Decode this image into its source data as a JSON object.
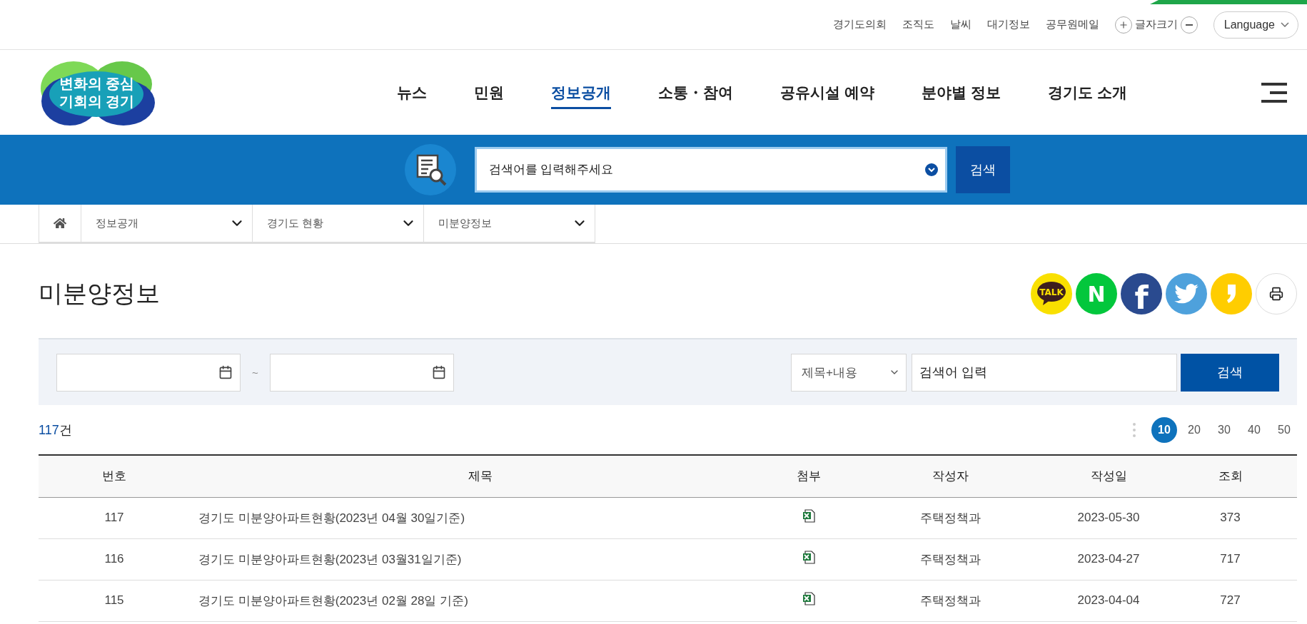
{
  "utility_links": [
    "경기도의회",
    "조직도",
    "날씨",
    "대기정보",
    "공무원메일"
  ],
  "font_size": {
    "label": "글자크기"
  },
  "language": {
    "label": "Language"
  },
  "logo": {
    "lines": [
      "변화의 중심",
      "기회의 경기"
    ]
  },
  "nav": [
    {
      "label": "뉴스",
      "selected": false
    },
    {
      "label": "민원",
      "selected": false
    },
    {
      "label": "정보공개",
      "selected": true
    },
    {
      "label": "소통・참여",
      "selected": false
    },
    {
      "label": "공유시설 예약",
      "selected": false
    },
    {
      "label": "분야별 정보",
      "selected": false
    },
    {
      "label": "경기도 소개",
      "selected": false
    }
  ],
  "search": {
    "placeholder": "검색어를 입력해주세요",
    "button": "검색"
  },
  "breadcrumb": [
    "정보공개",
    "경기도 현황",
    "미분양정보"
  ],
  "page_title": "미분양정보",
  "share": [
    {
      "kind": "kakaotalk",
      "text": "TALK"
    },
    {
      "kind": "naver",
      "text": "N"
    },
    {
      "kind": "facebook",
      "text": "f"
    },
    {
      "kind": "twitter"
    },
    {
      "kind": "story"
    },
    {
      "kind": "print"
    }
  ],
  "filter": {
    "separator": "~",
    "search_field": "제목+내용",
    "keyword_placeholder": "검색어 입력",
    "button": "검색"
  },
  "count": {
    "number": "117",
    "unit": "건"
  },
  "page_sizes": [
    {
      "label": "10",
      "selected": true
    },
    {
      "label": "20",
      "selected": false
    },
    {
      "label": "30",
      "selected": false
    },
    {
      "label": "40",
      "selected": false
    },
    {
      "label": "50",
      "selected": false
    }
  ],
  "table": {
    "columns": [
      "번호",
      "제목",
      "첨부",
      "작성자",
      "작성일",
      "조회"
    ],
    "rows": [
      {
        "no": "117",
        "title": "경기도 미분양아파트현황(2023년 04월 30일기준)",
        "attachment": true,
        "writer": "주택정책과",
        "date": "2023-05-30",
        "views": "373"
      },
      {
        "no": "116",
        "title": "경기도 미분양아파트현황(2023년 03월31일기준)",
        "attachment": true,
        "writer": "주택정책과",
        "date": "2023-04-27",
        "views": "717"
      },
      {
        "no": "115",
        "title": "경기도 미분양아파트현황(2023년 02월 28일 기준)",
        "attachment": true,
        "writer": "주택정책과",
        "date": "2023-04-04",
        "views": "727"
      }
    ]
  }
}
